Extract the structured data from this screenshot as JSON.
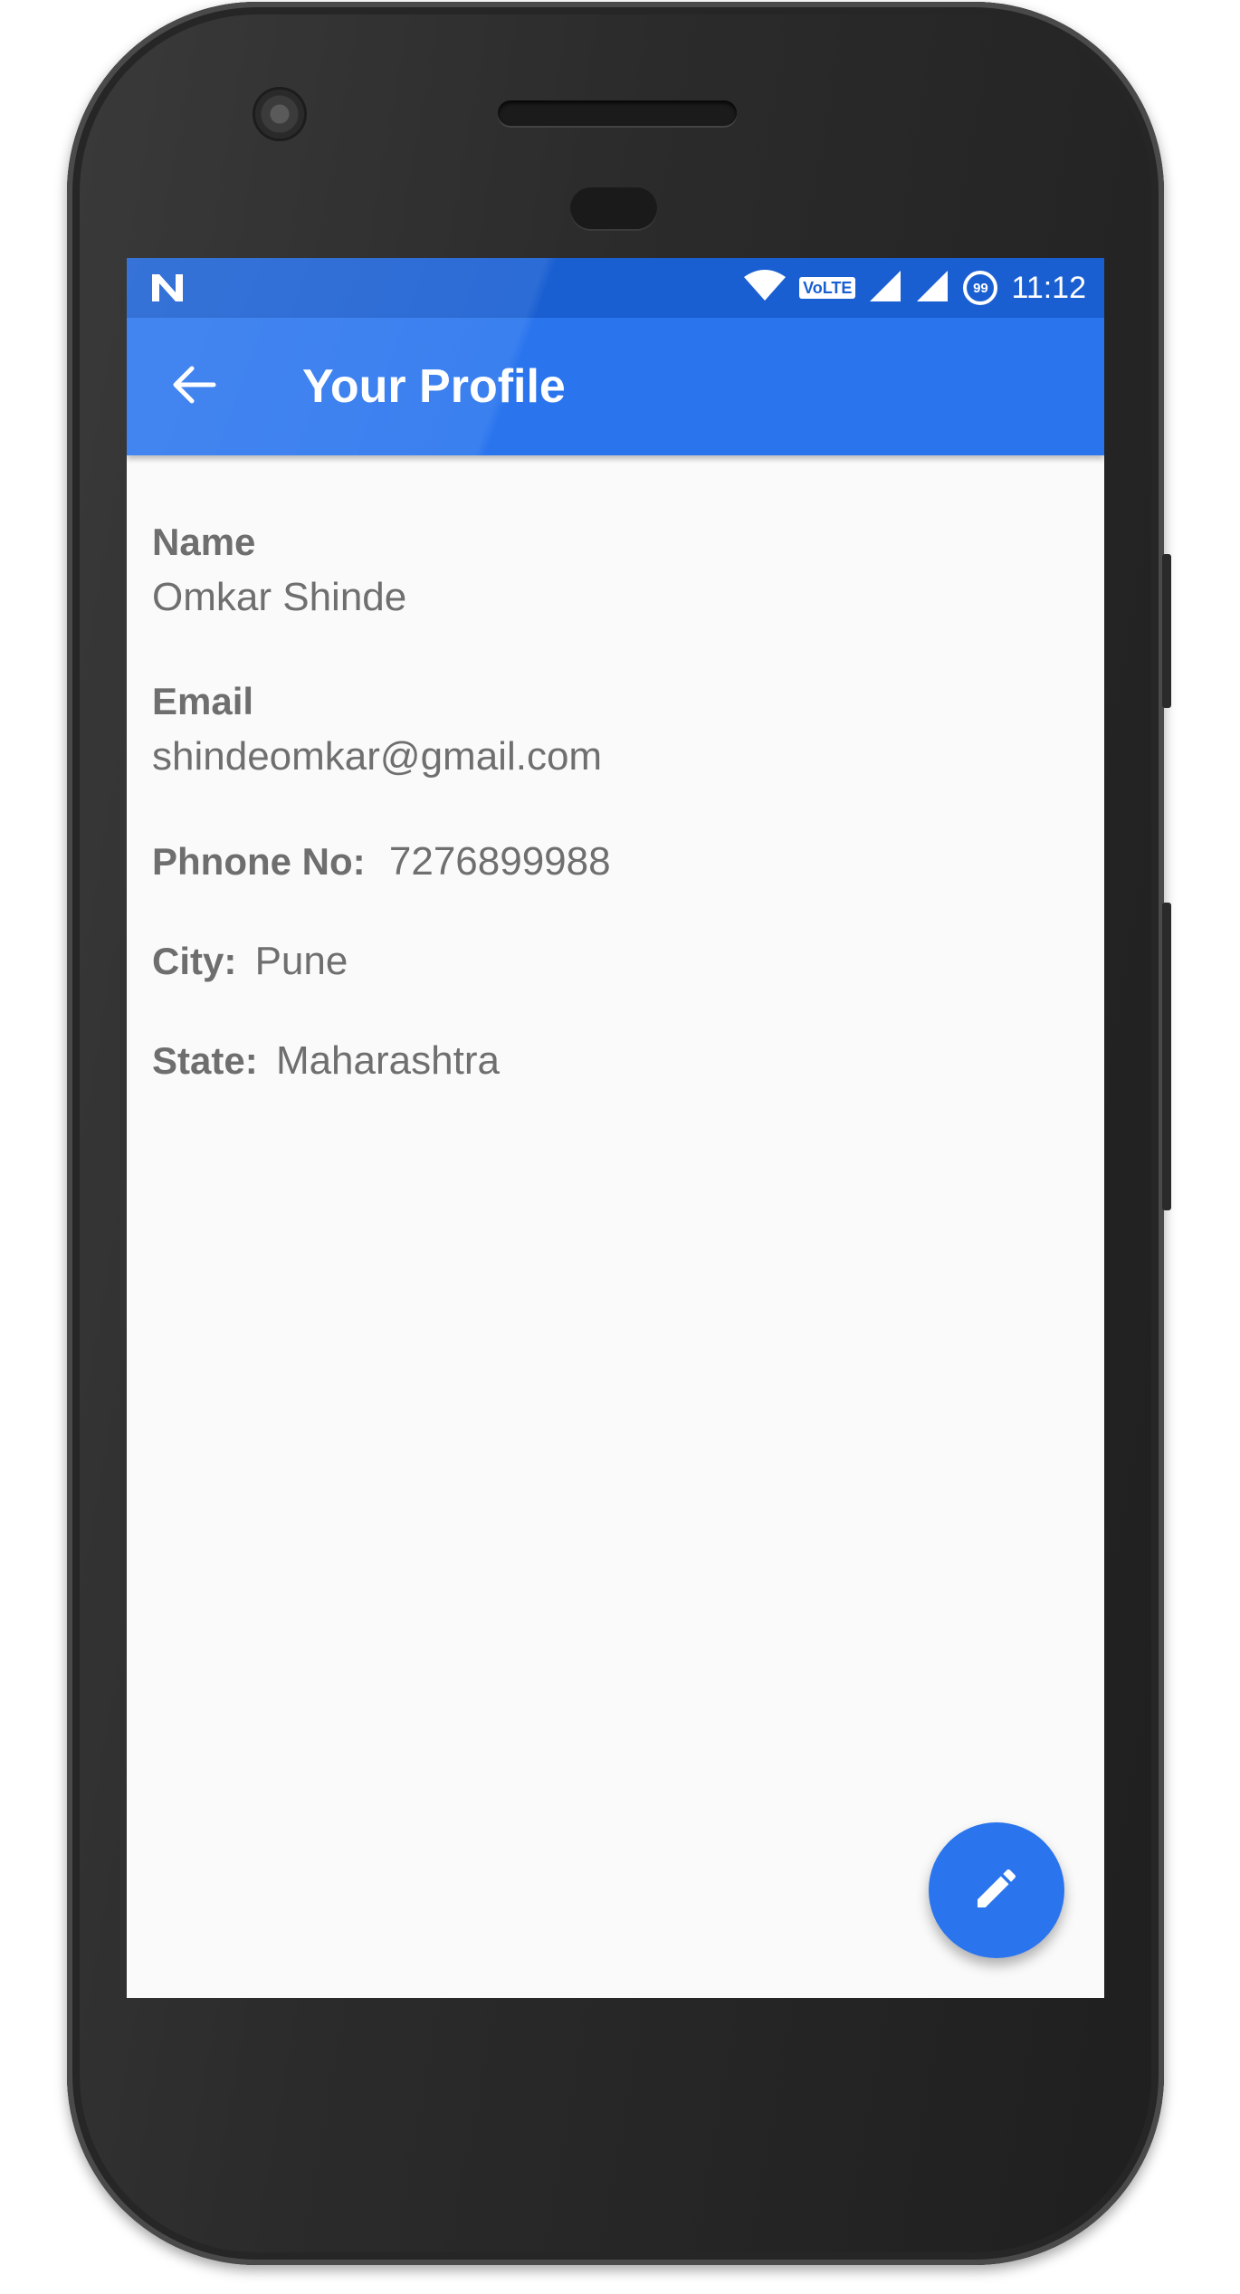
{
  "status_bar": {
    "notification_icon": "n-icon",
    "icons": [
      "wifi-icon",
      "volte-icon",
      "signal-icon",
      "signal-icon",
      "battery-icon"
    ],
    "volte_label": "VoLTE",
    "battery_level": "99",
    "time": "11:12"
  },
  "app_bar": {
    "back_icon": "arrow-left-icon",
    "title": "Your Profile",
    "color": "#2a75ee"
  },
  "profile": {
    "name_label": "Name",
    "name_value": "Omkar Shinde",
    "email_label": "Email",
    "email_value": "shindeomkar@gmail.com",
    "phone_label": "Phnone No:",
    "phone_value": "7276899988",
    "city_label": "City:",
    "city_value": "Pune",
    "state_label": "State:",
    "state_value": "Maharashtra"
  },
  "fab": {
    "icon": "pencil-icon",
    "color": "#2a75ee"
  }
}
